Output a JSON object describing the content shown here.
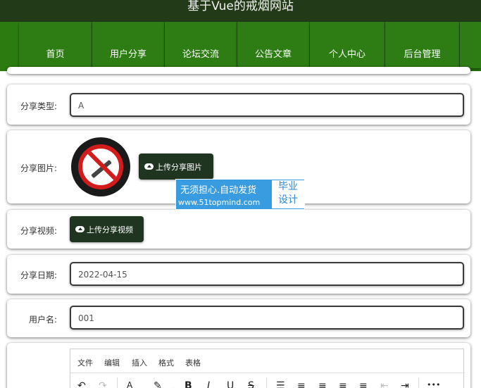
{
  "header": {
    "title": "基于Vue的戒烟网站"
  },
  "nav": {
    "items": [
      {
        "label": "首页"
      },
      {
        "label": "用户分享"
      },
      {
        "label": "论坛交流"
      },
      {
        "label": "公告文章"
      },
      {
        "label": "个人中心"
      },
      {
        "label": "后台管理"
      }
    ]
  },
  "form": {
    "share_type": {
      "label": "分享类型:",
      "value": "A"
    },
    "share_image": {
      "label": "分享图片:",
      "upload_button": "上传分享图片"
    },
    "share_video": {
      "label": "分享视频:",
      "upload_button": "上传分享视频"
    },
    "share_date": {
      "label": "分享日期:",
      "value": "2022-04-15"
    },
    "username": {
      "label": "用户名:",
      "value": "001"
    }
  },
  "editor": {
    "menu": [
      "文件",
      "编辑",
      "插入",
      "格式",
      "表格"
    ],
    "toolbar": {
      "undo": "↶",
      "redo": "↷",
      "font_color": "A",
      "highlight": "✎",
      "bold": "B",
      "italic": "I",
      "underline": "U",
      "strike": "S",
      "line_height": "☰",
      "align_left": "≡",
      "align_center": "≡",
      "align_right": "≡",
      "justify": "≡",
      "outdent": "⇤",
      "indent": "⇥",
      "more": "•••"
    }
  },
  "watermark": {
    "line1": "无须担心.自动发货",
    "line2": "www.51topmind.com",
    "badge_top": "毕业",
    "badge_bottom": "设计"
  }
}
